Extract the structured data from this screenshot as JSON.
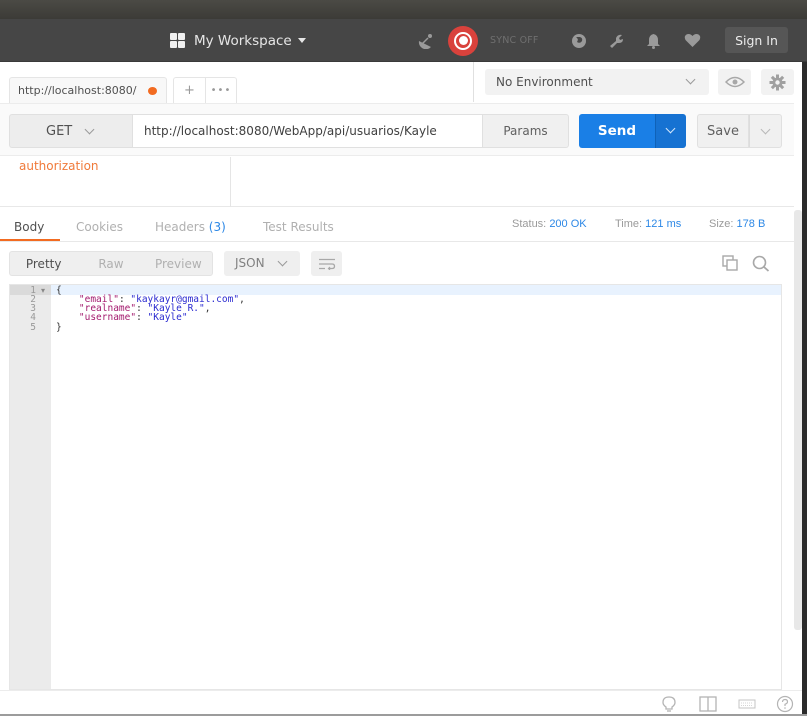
{
  "header": {
    "workspace_label": "My Workspace",
    "sync_label": "SYNC OFF",
    "signin_label": "Sign In",
    "icons": [
      "interceptor-icon",
      "sync-icon",
      "globe-icon",
      "wrench-icon",
      "bell-icon",
      "heart-icon"
    ]
  },
  "tabs": {
    "items": [
      {
        "label": "http://localhost:8080/",
        "unsaved": true,
        "active": true
      }
    ],
    "new_tab_label": "+",
    "more_label": "•••"
  },
  "environment": {
    "selected": "No Environment"
  },
  "request": {
    "method": "GET",
    "url": "http://localhost:8080/WebApp/api/usuarios/Kayle",
    "params_label": "Params",
    "send_label": "Send",
    "save_label": "Save"
  },
  "builder": {
    "auth_link": "authorization"
  },
  "response": {
    "tabs": [
      {
        "label": "Body",
        "active": true
      },
      {
        "label": "Cookies",
        "active": false
      },
      {
        "label": "Headers",
        "count": "(3)",
        "active": false
      },
      {
        "label": "Test Results",
        "active": false
      }
    ],
    "status_label": "Status:",
    "status_value": "200 OK",
    "time_label": "Time:",
    "time_value": "121 ms",
    "size_label": "Size:",
    "size_value": "178 B",
    "view_modes": [
      "Pretty",
      "Raw",
      "Preview"
    ],
    "active_view": "Pretty",
    "format": "JSON",
    "body_lines": [
      {
        "n": "1",
        "fold": true,
        "text": "{"
      },
      {
        "n": "2",
        "key": "\"email\"",
        "value": "\"kaykayr@gmail.com\"",
        "trail": ","
      },
      {
        "n": "3",
        "key": "\"realname\"",
        "value": "\"Kayle R.\"",
        "trail": ","
      },
      {
        "n": "4",
        "key": "\"username\"",
        "value": "\"Kayle\"",
        "trail": ""
      },
      {
        "n": "5",
        "text": "}"
      }
    ]
  },
  "colors": {
    "accent_blue": "#1a7fe6",
    "accent_orange": "#f26b21",
    "sync_red": "#d9423c",
    "header_bg": "#464646"
  }
}
